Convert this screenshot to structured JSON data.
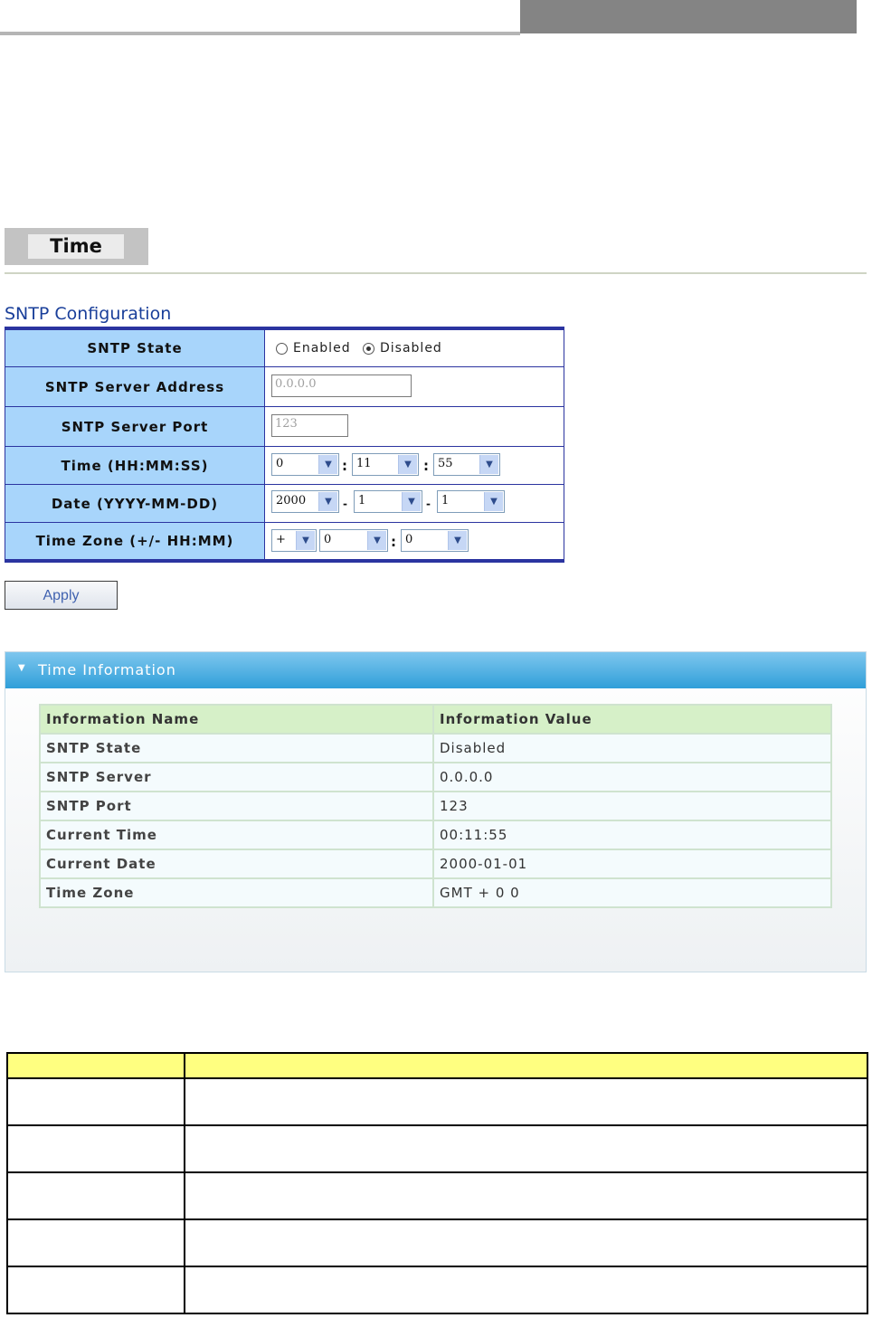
{
  "page": {
    "tab_title": "Time",
    "section_title": "SNTP Configuration"
  },
  "config": {
    "rows": [
      {
        "label": "SNTP State"
      },
      {
        "label": "SNTP Server Address"
      },
      {
        "label": "SNTP Server Port"
      },
      {
        "label": "Time (HH:MM:SS)"
      },
      {
        "label": "Date (YYYY-MM-DD)"
      },
      {
        "label": "Time Zone (+/- HH:MM)"
      }
    ],
    "state": {
      "enabled_label": "Enabled",
      "disabled_label": "Disabled",
      "selected": "Disabled"
    },
    "server_address": "0.0.0.0",
    "server_port": "123",
    "time": {
      "hh": "0",
      "mm": "11",
      "ss": "55"
    },
    "date": {
      "yyyy": "2000",
      "mm": "1",
      "dd": "1"
    },
    "timezone": {
      "sign": "+",
      "hh": "0",
      "mm": "0"
    },
    "time_sep": ":",
    "date_sep": "-",
    "apply_label": "Apply"
  },
  "info": {
    "panel_title": "Time Information",
    "headers": [
      "Information Name",
      "Information Value"
    ],
    "rows": [
      {
        "name": "SNTP State",
        "value": "Disabled"
      },
      {
        "name": "SNTP Server",
        "value": "0.0.0.0"
      },
      {
        "name": "SNTP Port",
        "value": "123"
      },
      {
        "name": "Current Time",
        "value": "00:11:55"
      },
      {
        "name": "Current Date",
        "value": "2000-01-01"
      },
      {
        "name": "Time Zone",
        "value": "GMT + 0 0"
      }
    ]
  },
  "colors": {
    "label_bg": "#a8d5fb",
    "table_border": "#2b34a0",
    "title_blue": "#1a3f9a",
    "panel_bar": "#2f9fd9",
    "info_header": "#d6f0c8",
    "desc_header": "#ffff80"
  }
}
